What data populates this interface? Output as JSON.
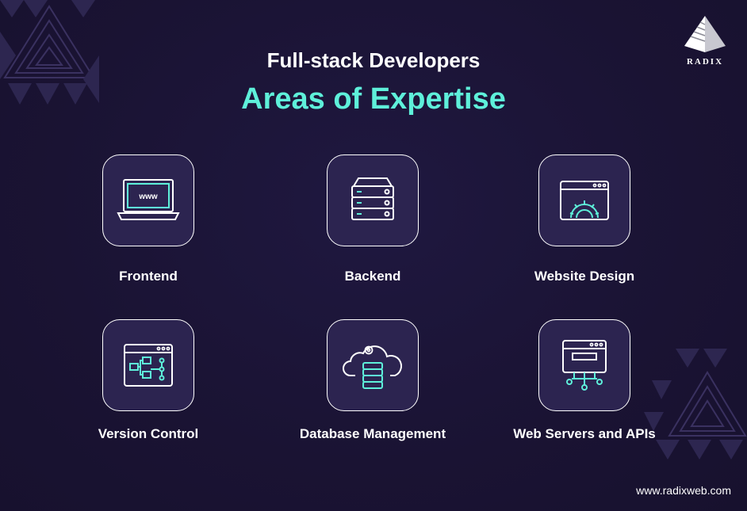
{
  "header": {
    "title": "Full-stack Developers",
    "subtitle": "Areas of Expertise"
  },
  "brand": {
    "name": "RADIX",
    "website": "www.radixweb.com"
  },
  "colors": {
    "background": "#1a1333",
    "accent": "#5ef0da",
    "text": "#ffffff",
    "tile": "#2c2450"
  },
  "areas": [
    {
      "label": "Frontend",
      "icon": "laptop-www-icon",
      "icon_text": "www"
    },
    {
      "label": "Backend",
      "icon": "server-rack-icon"
    },
    {
      "label": "Website Design",
      "icon": "browser-gear-icon"
    },
    {
      "label": "Version Control",
      "icon": "browser-flowchart-icon"
    },
    {
      "label": "Database Management",
      "icon": "cloud-database-icon"
    },
    {
      "label": "Web Servers and APIs",
      "icon": "browser-api-icon"
    }
  ]
}
